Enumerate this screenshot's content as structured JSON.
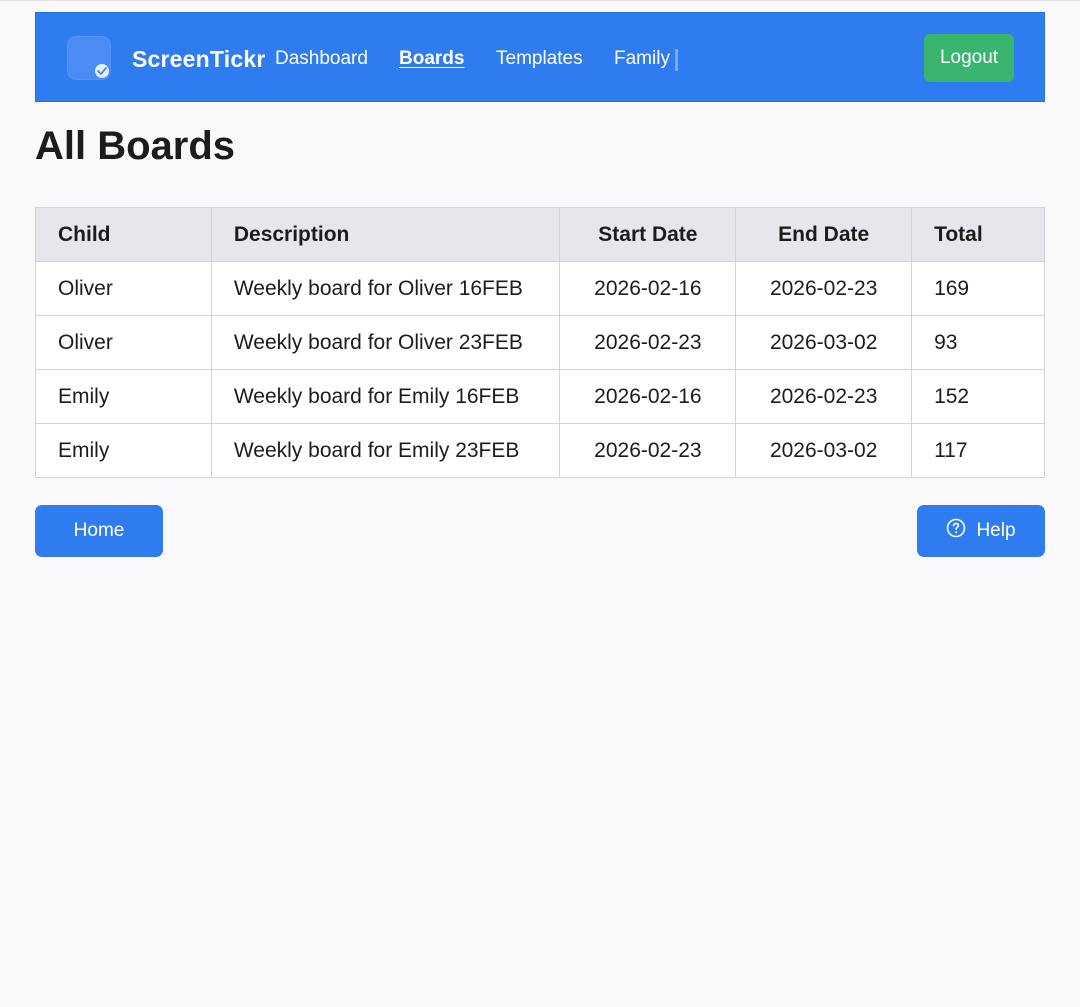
{
  "app": {
    "brand": "ScreenTickr"
  },
  "nav": {
    "links": [
      {
        "label": "Dashboard",
        "active": false
      },
      {
        "label": "Boards",
        "active": true
      },
      {
        "label": "Templates",
        "active": false
      },
      {
        "label": "Family",
        "active": false
      }
    ],
    "logout_label": "Logout"
  },
  "page": {
    "title": "All Boards"
  },
  "table": {
    "headers": [
      "Child",
      "Description",
      "Start Date",
      "End Date",
      "Total"
    ],
    "rows": [
      [
        "Oliver",
        "Weekly board for Oliver 16FEB",
        "2026-02-16",
        "2026-02-23",
        "169"
      ],
      [
        "Oliver",
        "Weekly board for Oliver 23FEB",
        "2026-02-23",
        "2026-03-02",
        "93"
      ],
      [
        "Emily",
        "Weekly board for Emily 16FEB",
        "2026-02-16",
        "2026-02-23",
        "152"
      ],
      [
        "Emily",
        "Weekly board for Emily 23FEB",
        "2026-02-23",
        "2026-03-02",
        "117"
      ]
    ]
  },
  "footer": {
    "home_label": "Home",
    "help_label": "Help"
  },
  "icons": {
    "logo": "check-badge-icon",
    "help": "question-circle-icon"
  },
  "colors": {
    "primary": "#2f7bf0",
    "logout": "#39b56f",
    "background": "#f9f9fb",
    "table_header": "#e6e7ec"
  }
}
